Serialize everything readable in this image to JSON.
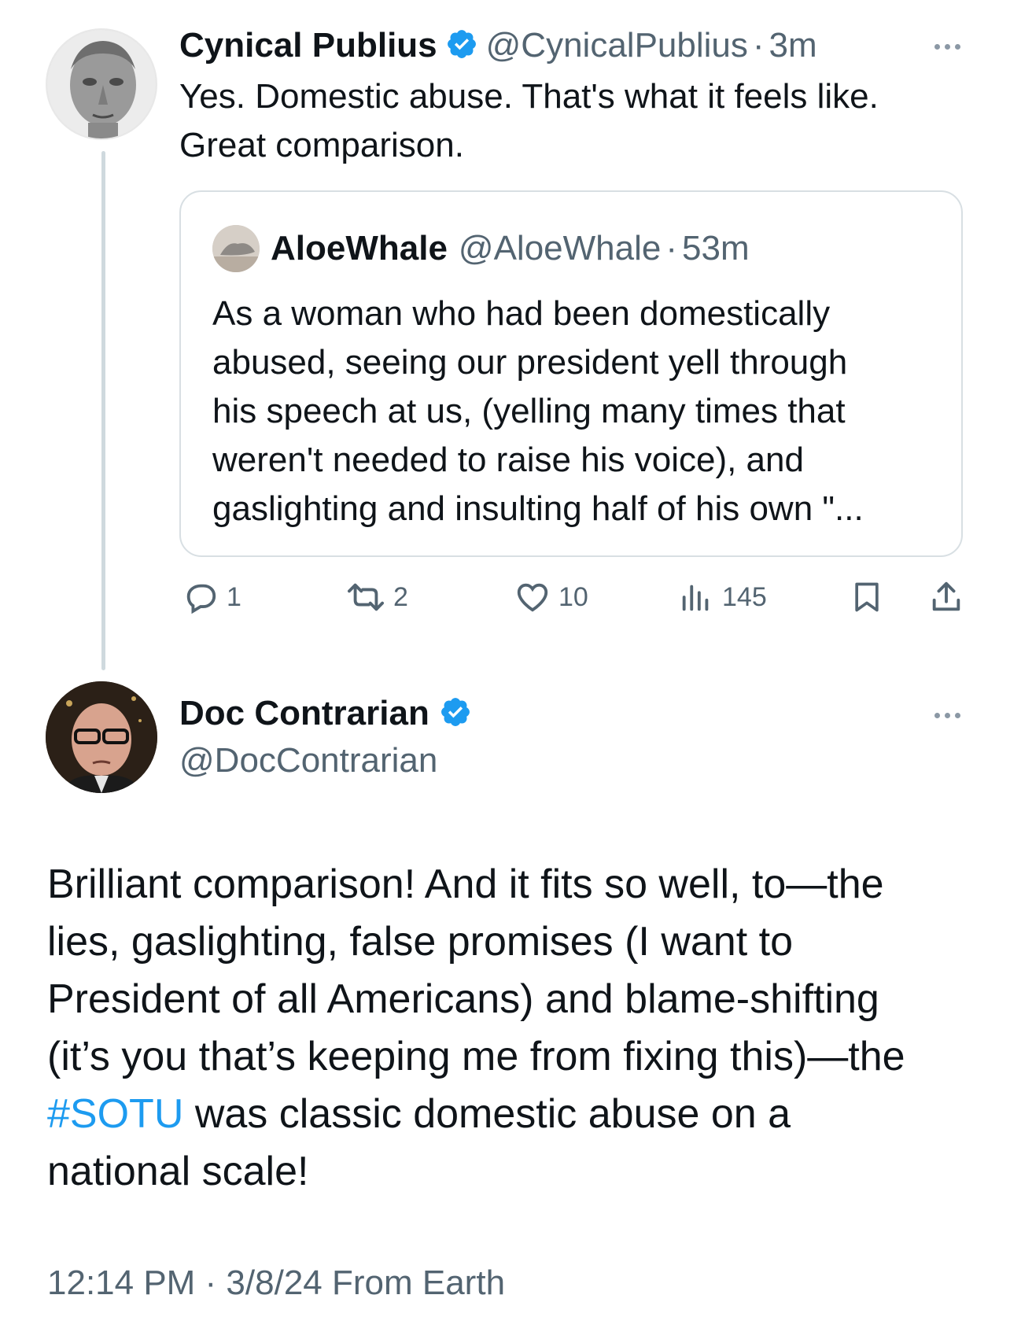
{
  "parent_tweet": {
    "author_name": "Cynical Publius",
    "handle": "@CynicalPublius",
    "separator": "·",
    "time": "3m",
    "text_line1": "Yes.  Domestic abuse.  That's what it feels like.",
    "text_line2": "Great comparison.",
    "verified": true,
    "quote": {
      "author_name": "AloeWhale",
      "handle": "@AloeWhale",
      "separator": "·",
      "time": "53m",
      "lines": [
        "As a woman who had been domestically",
        "abused, seeing our president yell through",
        "his speech at us, (yelling many times that",
        "weren't needed to raise his voice), and",
        "gaslighting and insulting half of his own \"..."
      ]
    },
    "actions": {
      "replies": "1",
      "reposts": "2",
      "likes": "10",
      "views": "145"
    }
  },
  "main_tweet": {
    "author_name": "Doc Contrarian",
    "handle": "@DocContrarian",
    "verified": true,
    "lines": [
      "Brilliant comparison! And it fits so well, to—the",
      "lies, gaslighting, false promises (I want to",
      "President of all Americans) and blame-shifting",
      "(it’s you that’s keeping me from fixing this)—the"
    ],
    "hashtag": "#SOTU",
    "line5_rest": " was classic domestic abuse on a",
    "line6": "national scale!",
    "timestamp": "12:14 PM · 3/8/24 From Earth"
  },
  "colors": {
    "accent": "#1d9bf0",
    "secondary_text": "#536471",
    "primary_text": "#0f1419",
    "border": "#cfd9de"
  }
}
